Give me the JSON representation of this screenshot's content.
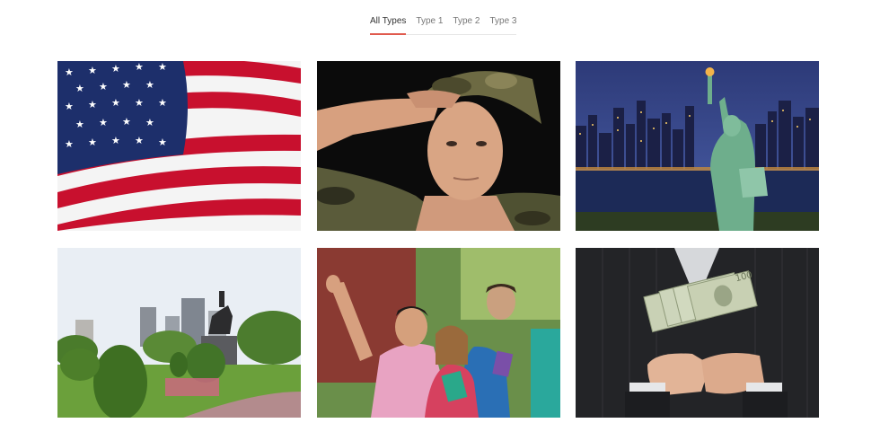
{
  "filter": {
    "tabs": [
      {
        "label": "All Types",
        "active": true
      },
      {
        "label": "Type 1",
        "active": false
      },
      {
        "label": "Type 2",
        "active": false
      },
      {
        "label": "Type 3",
        "active": false
      }
    ],
    "accent_color": "#e05a4e"
  },
  "gallery": {
    "items": [
      {
        "icon": "american-flag-image"
      },
      {
        "icon": "soldier-saluting-image"
      },
      {
        "icon": "statue-of-liberty-image"
      },
      {
        "icon": "park-statue-image"
      },
      {
        "icon": "students-cheering-image"
      },
      {
        "icon": "cash-in-hands-image"
      }
    ]
  }
}
